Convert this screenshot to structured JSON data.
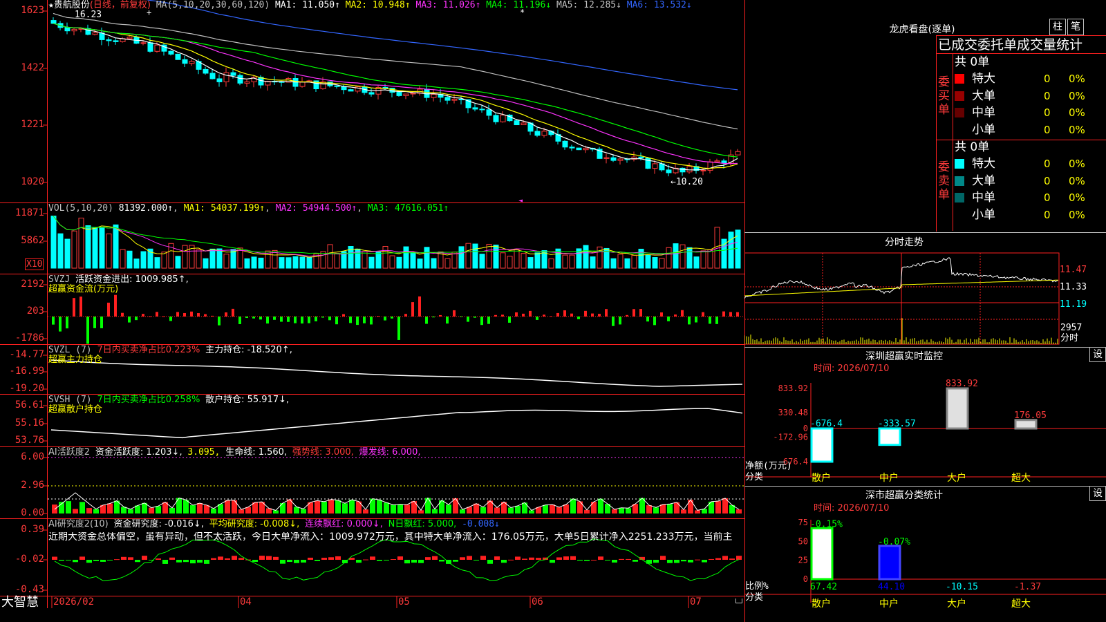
{
  "header": {
    "star": "★",
    "stock_name": "贵航股份",
    "period": "(日线，前复权)",
    "ma_label": "MA(5,10,20,30,60,120)",
    "ma": [
      {
        "label": "MA1:",
        "value": "11.050↑",
        "color": "#ffffff"
      },
      {
        "label": "MA2:",
        "value": "10.948↑",
        "color": "#ffff00"
      },
      {
        "label": "MA3:",
        "value": "11.026↑",
        "color": "#ff33ff"
      },
      {
        "label": "MA4:",
        "value": "11.196↓",
        "color": "#00ff00"
      },
      {
        "label": "MA5:",
        "value": "12.285↓",
        "color": "#c0c0c0"
      },
      {
        "label": "MA6:",
        "value": "13.532↓",
        "color": "#3366ff"
      }
    ],
    "high_marker": "16.23",
    "low_marker": "←10.20"
  },
  "price_axis": [
    "1623",
    "1422",
    "1221",
    "1020"
  ],
  "volume": {
    "label": "VOL(5,10,20)",
    "value": "81392.000↑",
    "ma1": "54037.199↑",
    "ma2": "54944.500↑",
    "ma3": "47616.051↑",
    "ma1_label": "MA1:",
    "ma2_label": "MA2:",
    "ma3_label": "MA3:",
    "axis": [
      "11871",
      "5862"
    ],
    "unit": "X10"
  },
  "svzj": {
    "label": "SVZJ",
    "text": "活跃资金进出: 1009.985↑,",
    "sub": "超赢资金流(万元)",
    "axis": [
      "2192",
      "203",
      "-1786"
    ]
  },
  "svzl": {
    "label": "SVZL (7)",
    "text1": "7日内买卖净占比0.223%",
    "text2": "主力持仓: -18.520↑,",
    "sub": "超赢主力持仓",
    "axis": [
      "-14.77",
      "-16.99",
      "-19.20"
    ]
  },
  "svsh": {
    "label": "SVSH (7)",
    "text1": "7日内买卖净占比0.258%",
    "text2": "散户持仓: 55.917↓,",
    "sub": "超赢散户持仓",
    "axis": [
      "56.61",
      "55.16",
      "53.76"
    ]
  },
  "ai1": {
    "label": "AI活跃度2",
    "text1": "资金活跃度: 1.203↓,",
    "text2": "3.095,",
    "text3": "生命线: 1.560,",
    "text4": "强势线: 3.000,",
    "text5": "爆发线: 6.000,",
    "axis": [
      "6.00",
      "2.96",
      "0.00"
    ]
  },
  "ai2": {
    "label": "AI研究度2(10)",
    "text1": "资金研究度: -0.016↓,",
    "text2": "平均研究度: -0.008↓,",
    "text3": "连续飘红: 0.000↓,",
    "text4": "N日飘红: 5.000,",
    "text5": "-0.008↓",
    "comment": "近期大资金总体偏空，虽有异动，但不太活跃，今日大单净流入：1009.972万元，其中特大单净流入：176.05万元，大单5日累计净入2251.233万元，当前主",
    "axis": [
      "0.39",
      "-0.02",
      "-0.43"
    ]
  },
  "bottom": {
    "brand": "大智慧",
    "dates": [
      "2026/02",
      "04",
      "05",
      "06",
      "07"
    ]
  },
  "longhu": {
    "title": "龙虎看盘(逐单)",
    "btn1": "柱",
    "btn2": "笔",
    "subtitle": "已成交委托单成交量统计",
    "buy": {
      "side": "委买单",
      "total": "共 0单",
      "rows": [
        {
          "name": "特大",
          "val": "0",
          "pct": "0%",
          "color": "#ff0000"
        },
        {
          "name": "大单",
          "val": "0",
          "pct": "0%",
          "color": "#990000"
        },
        {
          "name": "中单",
          "val": "0",
          "pct": "0%",
          "color": "#660000"
        },
        {
          "name": "小单",
          "val": "0",
          "pct": "0%",
          "color": "#000000"
        }
      ]
    },
    "sell": {
      "side": "委卖单",
      "total": "共 0单",
      "rows": [
        {
          "name": "特大",
          "val": "0",
          "pct": "0%",
          "color": "#00ffff"
        },
        {
          "name": "大单",
          "val": "0",
          "pct": "0%",
          "color": "#008888"
        },
        {
          "name": "中单",
          "val": "0",
          "pct": "0%",
          "color": "#006666"
        },
        {
          "name": "小单",
          "val": "0",
          "pct": "0%",
          "color": "#000000"
        }
      ]
    }
  },
  "intraday": {
    "title": "分时走势",
    "axis": [
      "11.47",
      "11.33",
      "11.19"
    ],
    "vol_label": "2957",
    "vol_unit": "分时"
  },
  "sz_monitor": {
    "title": "深圳超赢实时监控",
    "btn": "设",
    "time": "时间: 2026/07/10",
    "axis": [
      "833.92",
      "330.48",
      "0",
      "-172.96",
      "-676.4"
    ],
    "ylabel": "净额(万元)",
    "xlabel": "分类",
    "chart_data": {
      "type": "bar",
      "categories": [
        "散户",
        "中户",
        "大户",
        "超大"
      ],
      "values": [
        -676.4,
        -333.57,
        833.92,
        176.05
      ],
      "labels": [
        "-676.4",
        "-333.57",
        "833.92",
        "176.05"
      ],
      "ylabel": "净额(万元)",
      "xlabel": "分类",
      "ylim": [
        -676.4,
        833.92
      ]
    }
  },
  "sz_category": {
    "title": "深市超赢分类统计",
    "btn": "设",
    "time": "时间: 2026/07/10",
    "axis": [
      "75",
      "50",
      "25",
      "0"
    ],
    "ylabel": "比例%",
    "xlabel": "分类",
    "chart_data": {
      "type": "bar",
      "categories": [
        "散户",
        "中户",
        "大户",
        "超大"
      ],
      "values": [
        67.42,
        44.1,
        -10.15,
        -1.37
      ],
      "changes": [
        "-0.15%",
        "-0.07%",
        "",
        ""
      ],
      "labels": [
        "67.42",
        "44.10",
        "-10.15",
        "-1.37"
      ],
      "ylim": [
        0,
        75
      ]
    }
  }
}
